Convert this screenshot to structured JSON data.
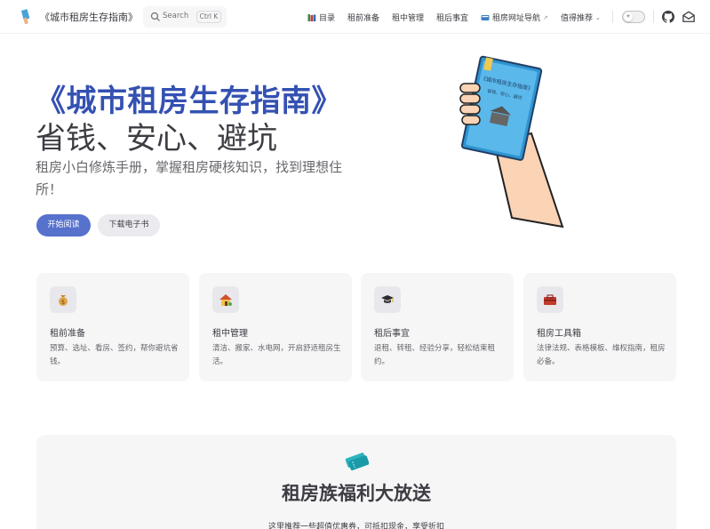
{
  "nav": {
    "title": "《城市租房生存指南》",
    "search_label": "Search",
    "search_kbd": "Ctrl K",
    "links": [
      {
        "label": "目录",
        "icon": "books-icon"
      },
      {
        "label": "租前准备"
      },
      {
        "label": "租中管理"
      },
      {
        "label": "租后事宜"
      },
      {
        "label": "租房网址导航",
        "icon": "card-index-icon",
        "external": "↗"
      },
      {
        "label": "值得推荐",
        "dropdown": "⌄"
      }
    ]
  },
  "hero": {
    "name": "《城市租房生存指南》",
    "text": "省钱、安心、避坑",
    "tagline": "租房小白修炼手册，掌握租房硬核知识，找到理想住所！",
    "actions": [
      {
        "label": "开始阅读"
      },
      {
        "label": "下载电子书"
      }
    ],
    "book_title": "《城市租房生存指南》",
    "book_sub": "省钱、安心、避坑"
  },
  "features": [
    {
      "icon": "money-bag-icon",
      "title": "租前准备",
      "details": "预算、选址、看房、签约，帮你避坑省钱。"
    },
    {
      "icon": "house-icon",
      "title": "租中管理",
      "details": "清洁、搬家、水电网，开启舒适租房生活。"
    },
    {
      "icon": "graduation-cap-icon",
      "title": "租后事宜",
      "details": "退租、转租、经验分享，轻松结束租约。"
    },
    {
      "icon": "toolbox-icon",
      "title": "租房工具箱",
      "details": "法律法规、表格模板、维权指南，租房必备。"
    }
  ],
  "welfare": {
    "title": "租房族福利大放送",
    "subtitle": "这里推荐一些超值优惠券，可抵扣现金，享受折扣"
  },
  "colors": {
    "brand": "#3451b2",
    "button": "#5672cd",
    "card_bg": "#f6f6f7"
  }
}
